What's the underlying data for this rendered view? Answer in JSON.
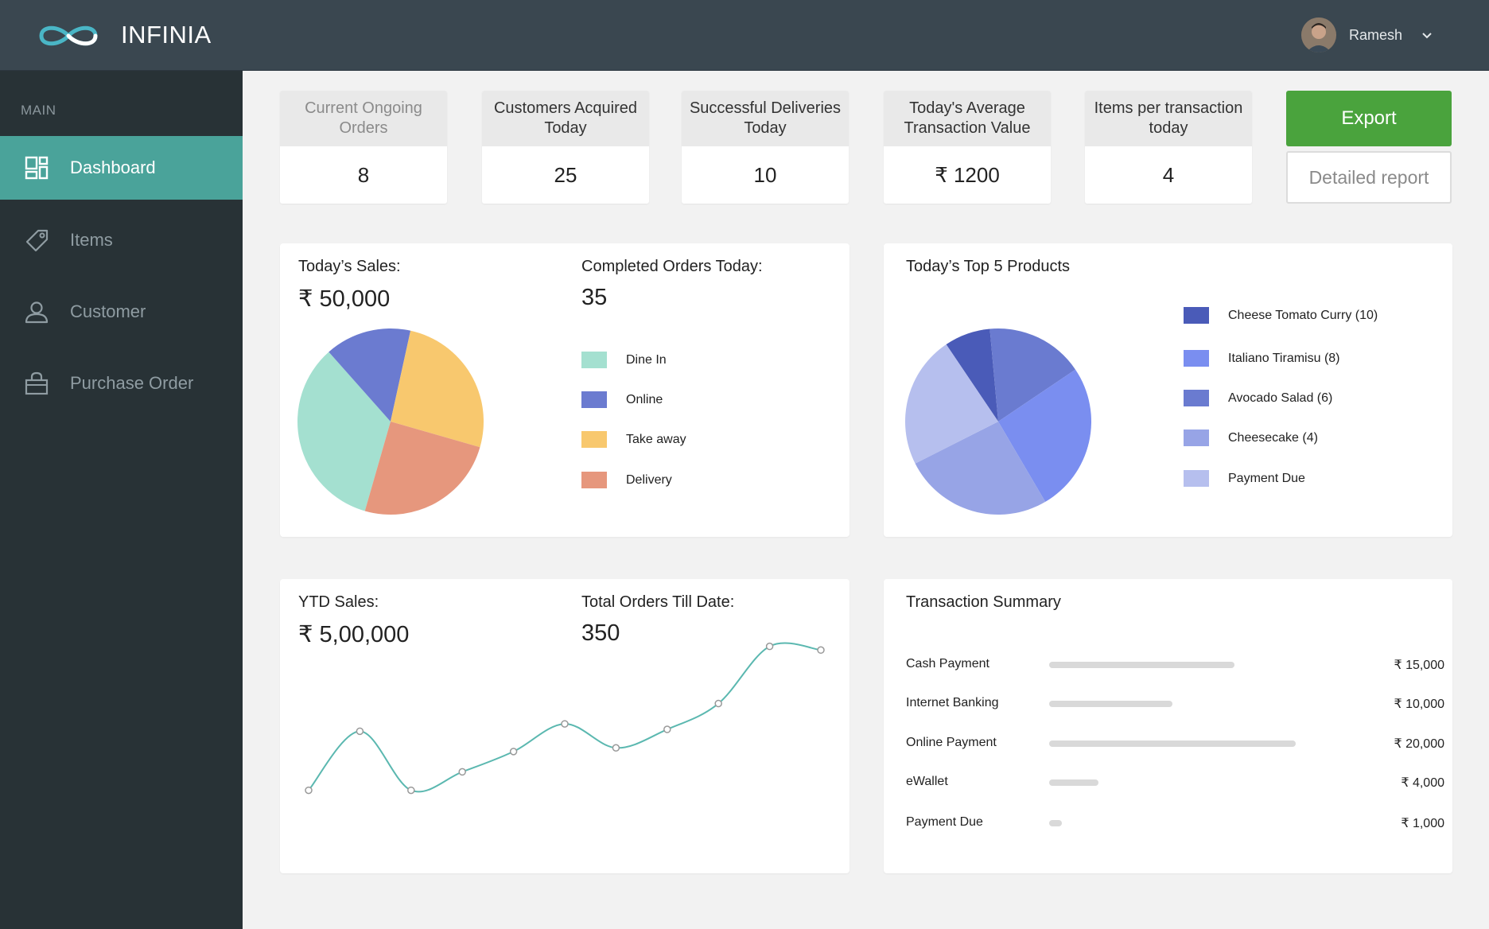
{
  "app": {
    "brand": "INFINIA"
  },
  "user": {
    "name": "Ramesh"
  },
  "sidebar": {
    "section": "MAIN",
    "items": [
      {
        "label": "Dashboard",
        "icon": "dashboard-icon",
        "active": true
      },
      {
        "label": "Items",
        "icon": "tag-icon",
        "active": false
      },
      {
        "label": "Customer",
        "icon": "user-icon",
        "active": false
      },
      {
        "label": "Purchase Order",
        "icon": "shopping-bag-icon",
        "active": false
      }
    ]
  },
  "kpis": [
    {
      "label": "Current Ongoing Orders",
      "value": "8"
    },
    {
      "label": "Customers Acquired Today",
      "value": "25"
    },
    {
      "label": "Successful Deliveries Today",
      "value": "10"
    },
    {
      "label": "Today's Average Transaction Value",
      "value": "₹ 1200"
    },
    {
      "label": "Items per transaction today",
      "value": "4"
    }
  ],
  "actions": {
    "export": "Export",
    "detailed_report": "Detailed report"
  },
  "sales": {
    "sales_label": "Today’s Sales:",
    "sales_value": "₹ 50,000",
    "orders_label": "Completed Orders Today:",
    "orders_value": "35"
  },
  "top_products": {
    "title": "Today’s Top 5 Products"
  },
  "ytd": {
    "sales_label": "YTD Sales:",
    "sales_value": "₹ 5,00,000",
    "orders_label": "Total Orders Till Date:",
    "orders_value": "350"
  },
  "transactions": {
    "title": "Transaction Summary",
    "rows": [
      {
        "label": "Cash Payment",
        "amount": "₹ 15,000",
        "value": 15000
      },
      {
        "label": "Internet Banking",
        "amount": "₹ 10,000",
        "value": 10000
      },
      {
        "label": "Online Payment",
        "amount": "₹ 20,000",
        "value": 20000
      },
      {
        "label": "eWallet",
        "amount": "₹ 4,000",
        "value": 4000
      },
      {
        "label": "Payment Due",
        "amount": "₹ 1,000",
        "value": 1000
      }
    ]
  },
  "colors": {
    "topbar": "#3a4750",
    "sidebar": "#283236",
    "active": "#4aa39a",
    "export": "#4aa33d"
  },
  "chart_data": [
    {
      "type": "pie",
      "categories": [
        "Dine In",
        "Online",
        "Take away",
        "Delivery"
      ],
      "values": [
        34,
        15,
        26,
        25
      ],
      "colors": [
        "#a4e0d0",
        "#6b7bd0",
        "#f8c86e",
        "#e6977d"
      ]
    },
    {
      "type": "pie",
      "categories": [
        "Cheese Tomato Curry (10)",
        "Italiano Tiramisu (8)",
        "Avocado Salad (6)",
        "Cheesecake (4)",
        "Payment Due"
      ],
      "values": [
        8,
        17,
        26,
        26,
        23
      ],
      "colors": [
        "#4a5bb8",
        "#6a7bd0",
        "#7a8ef0",
        "#97a4e6",
        "#b6bfee"
      ]
    },
    {
      "type": "line",
      "values": [
        2,
        5.2,
        2,
        3,
        4.1,
        5.6,
        4.3,
        5.3,
        6.7,
        9.8,
        9.6
      ],
      "color": "#5bb8b0"
    }
  ]
}
